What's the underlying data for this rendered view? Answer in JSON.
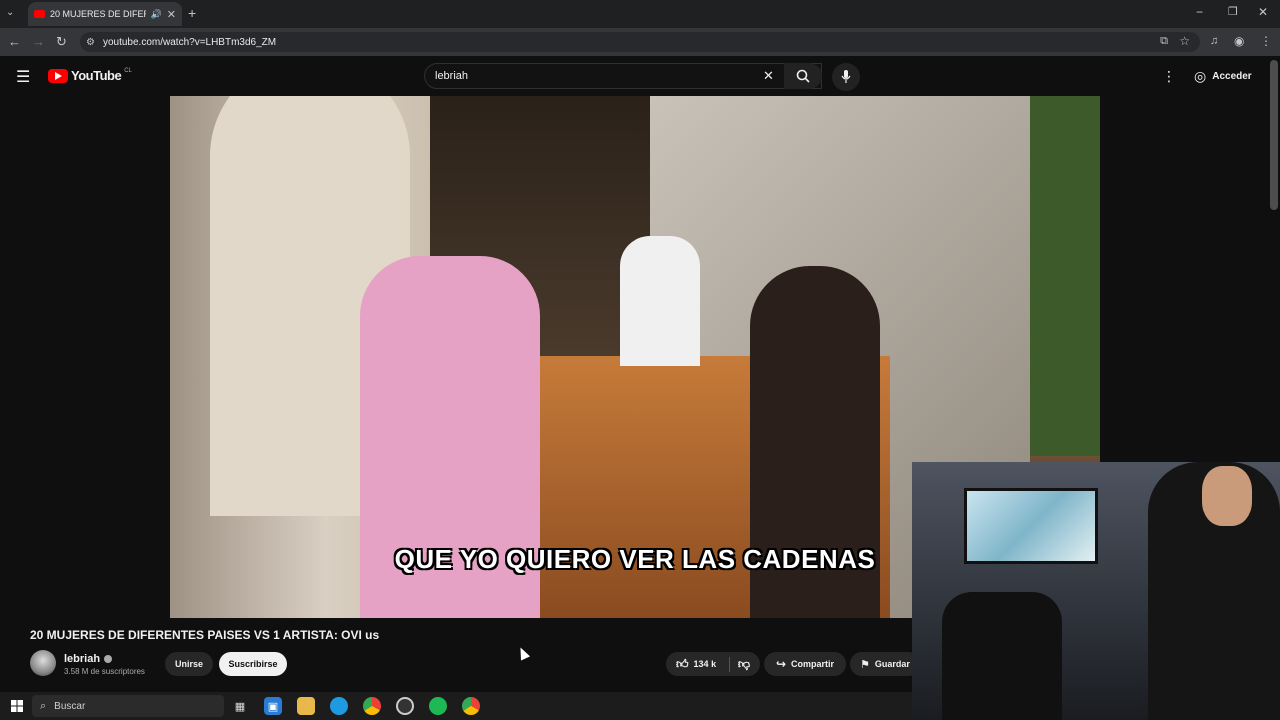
{
  "browser": {
    "tab_title": "20 MUJERES DE DIFERENTE",
    "url": "youtube.com/watch?v=LHBTm3d6_ZM"
  },
  "youtube": {
    "logo_text": "YouTube",
    "region": "CL",
    "search_value": "lebriah",
    "signin_label": "Acceder"
  },
  "video": {
    "subtitle": "QUE YO QUIERO VER LAS CADENAS",
    "title": "20 MUJERES DE DIFERENTES PAISES VS 1 ARTISTA: OVI us"
  },
  "channel": {
    "name": "lebriah",
    "subscribers": "3.58 M de suscriptores",
    "join_label": "Unirse",
    "subscribe_label": "Suscribirse"
  },
  "actions": {
    "likes": "134 k",
    "share_label": "Compartir",
    "save_label": "Guardar"
  },
  "taskbar": {
    "search_placeholder": "Buscar"
  },
  "colors": {
    "youtube_red": "#ff0000",
    "background": "#0f0f0f"
  }
}
